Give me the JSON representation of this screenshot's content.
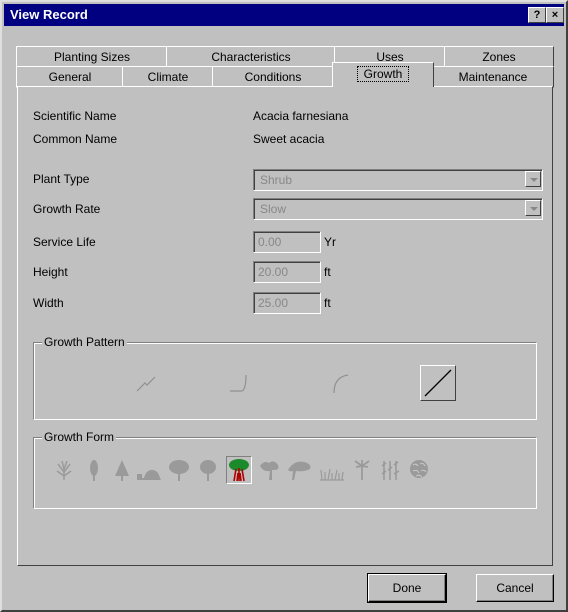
{
  "window": {
    "title": "View Record",
    "help_label": "?",
    "close_label": "×"
  },
  "tabs_row1": [
    "Planting Sizes",
    "Characteristics",
    "Uses",
    "Zones"
  ],
  "tabs_row2": [
    "General",
    "Climate",
    "Conditions",
    "Growth",
    "Maintenance"
  ],
  "active_tab": "Growth",
  "record": {
    "scientific_name_label": "Scientific Name",
    "scientific_name": "Acacia farnesiana",
    "common_name_label": "Common Name",
    "common_name": "Sweet acacia"
  },
  "fields": {
    "plant_type": {
      "label": "Plant Type",
      "value": "Shrub"
    },
    "growth_rate": {
      "label": "Growth Rate",
      "value": "Slow"
    },
    "service_life": {
      "label": "Service Life",
      "value": "0.00",
      "unit": "Yr"
    },
    "height": {
      "label": "Height",
      "value": "20.00",
      "unit": "ft"
    },
    "width": {
      "label": "Width",
      "value": "25.00",
      "unit": "ft"
    }
  },
  "growth_pattern": {
    "label": "Growth Pattern",
    "selected_index": 3
  },
  "growth_form": {
    "label": "Growth Form",
    "selected_index": 6
  },
  "buttons": {
    "done": "Done",
    "cancel": "Cancel"
  },
  "colors": {
    "titlebar": "#000080",
    "face": "#c0c0c0",
    "selected_tree": "#b00000",
    "tree_green": "#1a8a2a"
  }
}
